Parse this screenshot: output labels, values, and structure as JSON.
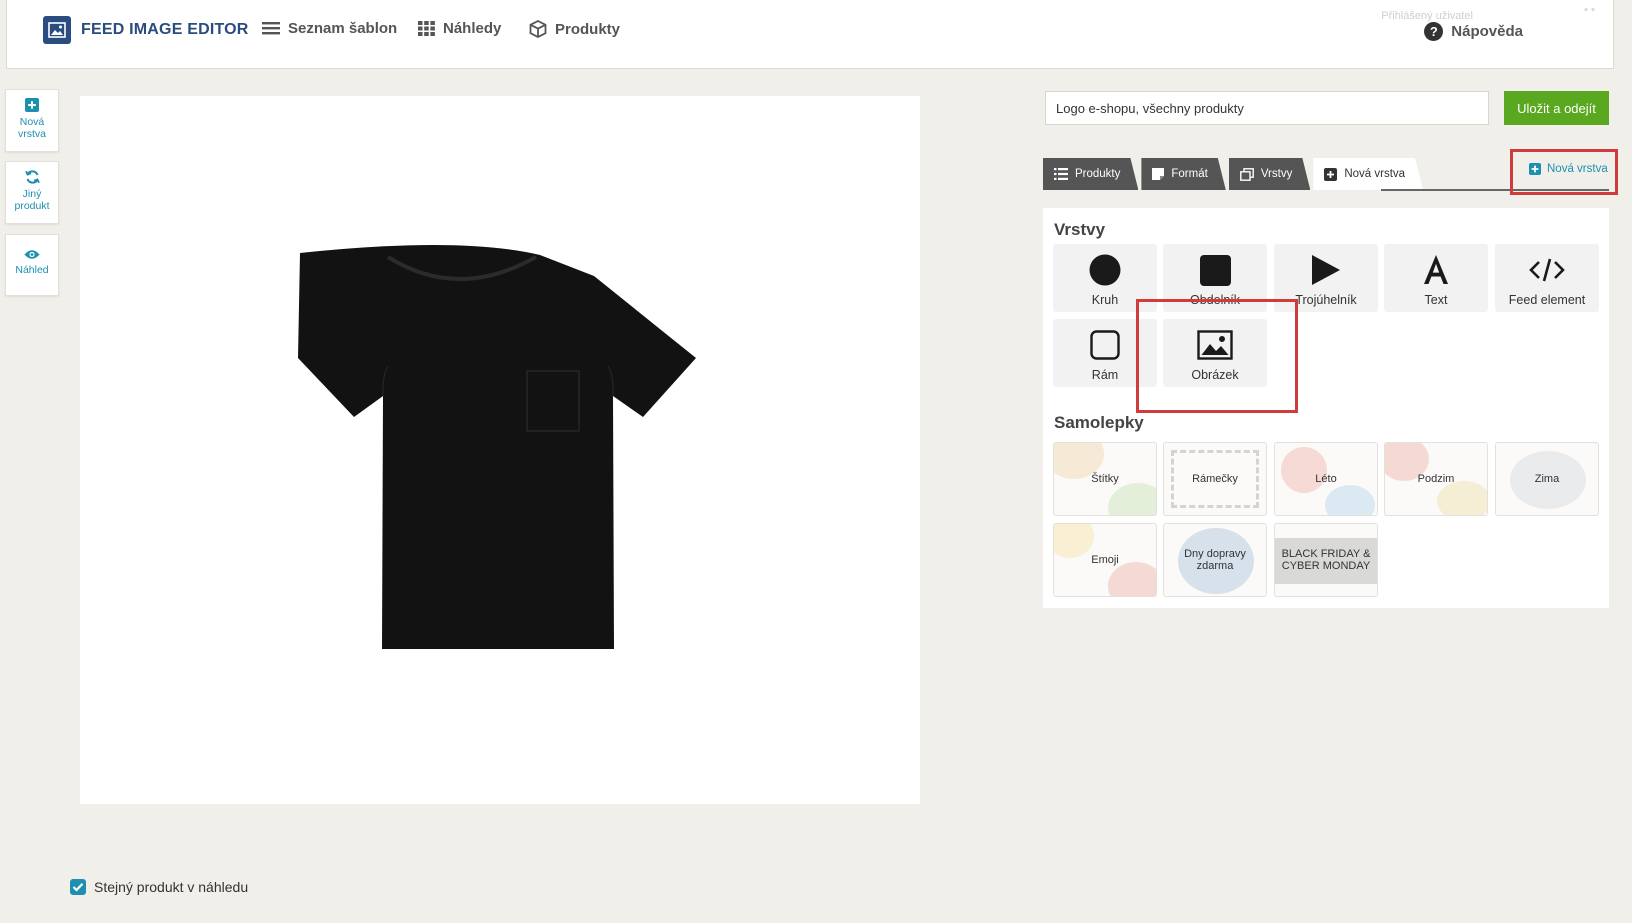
{
  "app": {
    "title": "FEED IMAGE EDITOR",
    "nav": [
      {
        "label": "Seznam šablon",
        "icon": "list-icon"
      },
      {
        "label": "Náhledy",
        "icon": "grid-icon"
      },
      {
        "label": "Produkty",
        "icon": "box-icon"
      }
    ],
    "help_label": "Nápověda",
    "faded_top_text": "Přihlášený uživatel"
  },
  "sidebar": [
    {
      "label": "Nová vrstva",
      "icon": "plus-square-icon"
    },
    {
      "label": "Jiný produkt",
      "icon": "refresh-icon"
    },
    {
      "label": "Náhled",
      "icon": "eye-icon"
    }
  ],
  "template": {
    "name_value": "Logo e-shopu, všechny produkty",
    "save_label": "Uložit a odejít"
  },
  "tabs": [
    {
      "label": "Produkty",
      "icon": "list-icon",
      "active": false
    },
    {
      "label": "Formát",
      "icon": "format-icon",
      "active": false
    },
    {
      "label": "Vrstvy",
      "icon": "layers-icon",
      "active": false
    },
    {
      "label": "Nová vrstva",
      "icon": "plus-square-icon",
      "active": true
    }
  ],
  "new_layer_link": "Nová vrstva",
  "layers": {
    "title": "Vrstvy",
    "items": [
      {
        "label": "Kruh",
        "icon": "circle-icon"
      },
      {
        "label": "Obdelník",
        "icon": "square-icon"
      },
      {
        "label": "Trojúhelník",
        "icon": "triangle-icon"
      },
      {
        "label": "Text",
        "icon": "text-icon"
      },
      {
        "label": "Feed element",
        "icon": "code-icon"
      },
      {
        "label": "Rám",
        "icon": "frame-icon"
      },
      {
        "label": "Obrázek",
        "icon": "image-icon"
      }
    ]
  },
  "stickers": {
    "title": "Samolepky",
    "items": [
      "Štítky",
      "Rámečky",
      "Léto",
      "Podzim",
      "Zima",
      "Emoji",
      "Dny dopravy zdarma",
      "BLACK FRIDAY & CYBER MONDAY"
    ]
  },
  "preview": {
    "same_product_label": "Stejný produkt v náhledu",
    "same_product_checked": true
  },
  "colors": {
    "accent": "#1d8fb0",
    "brand": "#2b4c7e",
    "save": "#5aa820",
    "highlight": "#d03b3b"
  }
}
